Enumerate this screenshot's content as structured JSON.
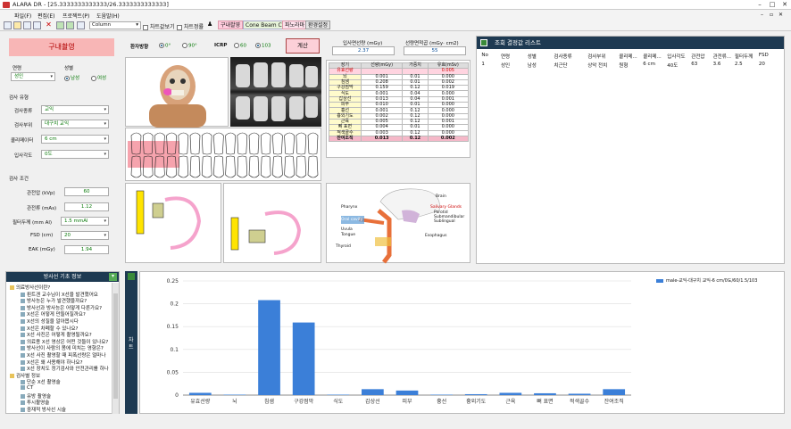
{
  "window": {
    "title": "ALARA DR - [25.3333333333333/26.3333333333333]"
  },
  "menu": [
    "파일(F)",
    "편집(E)",
    "프로젝트(P)",
    "도움말(H)"
  ],
  "toolbar": {
    "column_select": "Column",
    "chart_check": "차트값보기",
    "check2": "차트정률",
    "btn_intraoral": "구내촬영",
    "btn_cbct": "Cone Beam CT",
    "btn_pano": "파노라마",
    "btn_env": "환경설정"
  },
  "left": {
    "header": "구내촬영",
    "age_label": "연령",
    "age_value": "성인",
    "sex_label": "성별",
    "male": "남성",
    "female": "여성",
    "exam_type_title": "검사 유형",
    "exam_kind_label": "검사종류",
    "exam_kind_value": "교익",
    "exam_site_label": "검사부위",
    "exam_site_value": "대구치 교익",
    "collimator_label": "콜리메이터",
    "collimator_value": "6 cm",
    "angle_label": "입사각도",
    "angle_value": "0도",
    "cond_title": "검사 조건",
    "kvp_label": "관전압 (kVp)",
    "kvp_value": "60",
    "mas_label": "관전류 (mAs)",
    "mas_value": "1.12",
    "filter_label": "필터두께 (mm Al)",
    "filter_value": "1.5 mmAl",
    "fsd_label": "FSD (cm)",
    "fsd_value": "20",
    "eak_label": "EAK (mGy)",
    "eak_value": "1.94"
  },
  "center": {
    "patient_dir_label": "환자방향",
    "dir_0": "0°",
    "dir_90": "90°",
    "icrp_label": "ICRP",
    "icrp_60": "60",
    "icrp_103": "103",
    "calc_button": "계산",
    "entrance_dose_label": "입사면선량 (mGy)",
    "entrance_dose_value": "2.37",
    "dap_label": "선량면적곱 (mGy· cm2)",
    "dap_value": "55",
    "table_headers": [
      "장기",
      "선량(mGy)",
      "가중치",
      "유효(mSv)"
    ],
    "table_rows": [
      [
        "유효선량",
        "",
        "",
        "0.005"
      ],
      [
        "뇌",
        "0.001",
        "0.01",
        "0.000"
      ],
      [
        "침샘",
        "0.208",
        "0.01",
        "0.002"
      ],
      [
        "구강점막",
        "0.159",
        "0.12",
        "0.019"
      ],
      [
        "식도",
        "0.001",
        "0.04",
        "0.000"
      ],
      [
        "갑상선",
        "0.013",
        "0.04",
        "0.001"
      ],
      [
        "피부",
        "0.010",
        "0.01",
        "0.000"
      ],
      [
        "흉선",
        "0.001",
        "0.12",
        "0.000"
      ],
      [
        "흉외기도",
        "0.002",
        "0.12",
        "0.000"
      ],
      [
        "근육",
        "0.005",
        "0.12",
        "0.001"
      ],
      [
        "뼈 표면",
        "0.004",
        "0.01",
        "0.000"
      ],
      [
        "적색골수",
        "0.003",
        "0.12",
        "0.000"
      ],
      [
        "잔여조직",
        "0.013",
        "0.12",
        "0.002"
      ]
    ],
    "anatomy_labels": [
      "Brain",
      "Pharynx",
      "Salivary Glands",
      "Parotid",
      "Submandibular",
      "Sublingual",
      "Oral cavity",
      "Uvula",
      "Tongue",
      "Esophagus",
      "Thyroid"
    ]
  },
  "results": {
    "title": "조회 결정값 리스트",
    "columns": [
      "No",
      "연령",
      "성별",
      "검사종류",
      "검사부위",
      "콜리메...",
      "콜리메...",
      "입사각도",
      "관전압",
      "관전류...",
      "필터두께",
      "FSD"
    ],
    "rows": [
      [
        "1",
        "성인",
        "남성",
        "치근단",
        "상악 전치",
        "원형",
        "6 cm",
        "40도",
        "63",
        "3.6",
        "2.5",
        "20"
      ]
    ]
  },
  "info": {
    "title": "방사선 기초 정보",
    "tree": [
      {
        "level": 0,
        "text": "의료방사선이란?"
      },
      {
        "level": 1,
        "text": "뢴트겐 교수님이 X선을 발견했어요"
      },
      {
        "level": 1,
        "text": "방사능은 누가 발견했을까요?"
      },
      {
        "level": 1,
        "text": "방사선과 방사능은 어떻게 다른가요?"
      },
      {
        "level": 1,
        "text": "X선은 어떻게 만들어질까요?"
      },
      {
        "level": 1,
        "text": "X선의 성질을 알아봅시다"
      },
      {
        "level": 1,
        "text": "X선은 차폐할 수 있나요?"
      },
      {
        "level": 1,
        "text": "X선 사진은 어떻게 촬영될까요?"
      },
      {
        "level": 1,
        "text": "의료용 X선 영상은 어떤 것들이 있나요?"
      },
      {
        "level": 1,
        "text": "방사선이 사람의 몸에 미치는 영향은?"
      },
      {
        "level": 1,
        "text": "X선 사진 촬영할 때 피폭선량은 얼마나"
      },
      {
        "level": 1,
        "text": "X선은 왜 사용해야 하나요?"
      },
      {
        "level": 1,
        "text": "X선 장치도 정기검사와 안전관리를 하나"
      },
      {
        "level": 0,
        "text": "검사별 정보"
      },
      {
        "level": 1,
        "text": "단순 X선 촬영술"
      },
      {
        "level": 1,
        "text": "CT"
      },
      {
        "level": 1,
        "text": "유방 촬영술"
      },
      {
        "level": 1,
        "text": "투시촬영술"
      },
      {
        "level": 1,
        "text": "중재적 방사선 시술"
      }
    ],
    "side_tab": "차트"
  },
  "chart_data": {
    "type": "bar",
    "title": "",
    "xlabel": "",
    "ylabel": "",
    "ylim": [
      0,
      0.25
    ],
    "yticks": [
      "0",
      "0.05",
      "0.1",
      "0.15",
      "0.2",
      "0.25"
    ],
    "categories": [
      "유효선량",
      "뇌",
      "침샘",
      "구강점막",
      "식도",
      "갑상선",
      "피부",
      "흉선",
      "흉외기도",
      "근육",
      "뼈 표면",
      "적색골수",
      "잔여조직"
    ],
    "series": [
      {
        "name": "male-교익-대구치 교익-6 cm/0도/60/1.5/103",
        "color": "#3b7fd8",
        "values": [
          0.005,
          0.001,
          0.208,
          0.159,
          0.001,
          0.013,
          0.01,
          0.001,
          0.002,
          0.005,
          0.004,
          0.003,
          0.013
        ]
      }
    ],
    "grid": true,
    "legend": "top-right"
  }
}
